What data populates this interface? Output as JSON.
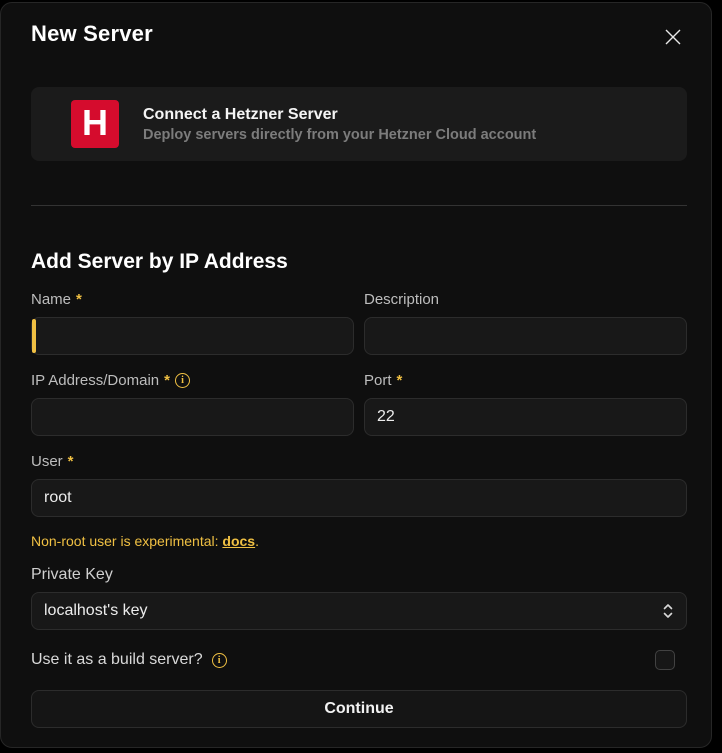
{
  "modal": {
    "title": "New Server"
  },
  "hetzner_card": {
    "logo_letter": "H",
    "logo_color": "#d50c2d",
    "title": "Connect a Hetzner Server",
    "subtitle": "Deploy servers directly from your Hetzner Cloud account"
  },
  "section": {
    "heading": "Add Server by IP Address"
  },
  "form": {
    "name": {
      "label": "Name",
      "required": "*",
      "value": ""
    },
    "description": {
      "label": "Description",
      "value": ""
    },
    "ip": {
      "label": "IP Address/Domain",
      "required": "*",
      "value": ""
    },
    "port": {
      "label": "Port",
      "required": "*",
      "value": "22"
    },
    "user": {
      "label": "User",
      "required": "*",
      "value": "root"
    },
    "note": {
      "prefix": "Non-root user is experimental: ",
      "link": "docs",
      "suffix": "."
    },
    "private_key": {
      "label": "Private Key",
      "selected": "localhost's key"
    },
    "build_server": {
      "label": "Use it as a build server?",
      "checked": false
    }
  },
  "footer": {
    "continue_label": "Continue"
  },
  "colors": {
    "accent_yellow": "#f0c043",
    "hetzner_red": "#d50c2d",
    "modal_bg": "#0f0f0f",
    "card_bg": "#1b1b1b"
  }
}
